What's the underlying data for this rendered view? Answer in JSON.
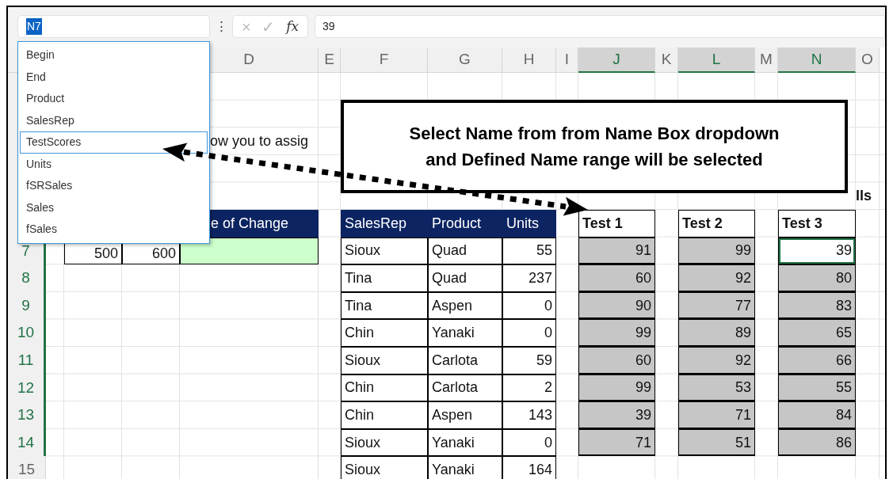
{
  "name_box": {
    "value": "N7"
  },
  "formula_bar": {
    "menu_glyph": "⋮",
    "cancel_glyph": "×",
    "enter_glyph": "✓",
    "function_label": "fx",
    "value": "39"
  },
  "columns": [
    {
      "label": "D",
      "selected": false
    },
    {
      "label": "E",
      "selected": false
    },
    {
      "label": "F",
      "selected": false
    },
    {
      "label": "G",
      "selected": false
    },
    {
      "label": "H",
      "selected": false
    },
    {
      "label": "I",
      "selected": false
    },
    {
      "label": "J",
      "selected": true
    },
    {
      "label": "K",
      "selected": false
    },
    {
      "label": "L",
      "selected": true
    },
    {
      "label": "M",
      "selected": false
    },
    {
      "label": "N",
      "selected": true
    },
    {
      "label": "O",
      "selected": false
    }
  ],
  "rows": [
    {
      "label": "7",
      "selected": true
    },
    {
      "label": "8",
      "selected": true
    },
    {
      "label": "9",
      "selected": true
    },
    {
      "label": "10",
      "selected": true
    },
    {
      "label": "11",
      "selected": true
    },
    {
      "label": "12",
      "selected": true
    },
    {
      "label": "13",
      "selected": true
    },
    {
      "label": "14",
      "selected": true
    },
    {
      "label": "15",
      "selected": false
    }
  ],
  "note": {
    "text": "ow you to assig"
  },
  "note_end": {
    "text": "lls"
  },
  "change_table": {
    "header": "e of Change",
    "values": [
      "500",
      "600"
    ]
  },
  "sales_table": {
    "columns": [
      "SalesRep",
      "Product",
      "Units"
    ],
    "rows": [
      [
        "Sioux",
        "Quad",
        "55"
      ],
      [
        "Tina",
        "Quad",
        "237"
      ],
      [
        "Tina",
        "Aspen",
        "0"
      ],
      [
        "Chin",
        "Yanaki",
        "0"
      ],
      [
        "Sioux",
        "Carlota",
        "59"
      ],
      [
        "Chin",
        "Carlota",
        "2"
      ],
      [
        "Chin",
        "Aspen",
        "143"
      ],
      [
        "Sioux",
        "Yanaki",
        "0"
      ],
      [
        "Sioux",
        "Yanaki",
        "164"
      ]
    ]
  },
  "test_tables": [
    {
      "title": "Test 1",
      "scores": [
        {
          "text": "91",
          "active": false
        },
        {
          "text": "60",
          "active": false
        },
        {
          "text": "90",
          "active": false
        },
        {
          "text": "99",
          "active": false
        },
        {
          "text": "60",
          "active": false
        },
        {
          "text": "99",
          "active": false
        },
        {
          "text": "39",
          "active": false
        },
        {
          "text": "71",
          "active": false
        }
      ]
    },
    {
      "title": "Test 2",
      "scores": [
        {
          "text": "99",
          "active": false
        },
        {
          "text": "92",
          "active": false
        },
        {
          "text": "77",
          "active": false
        },
        {
          "text": "89",
          "active": false
        },
        {
          "text": "92",
          "active": false
        },
        {
          "text": "53",
          "active": false
        },
        {
          "text": "71",
          "active": false
        },
        {
          "text": "51",
          "active": false
        }
      ]
    },
    {
      "title": "Test 3",
      "scores": [
        {
          "text": "39",
          "active": true
        },
        {
          "text": "80",
          "active": false
        },
        {
          "text": "83",
          "active": false
        },
        {
          "text": "65",
          "active": false
        },
        {
          "text": "66",
          "active": false
        },
        {
          "text": "55",
          "active": false
        },
        {
          "text": "84",
          "active": false
        },
        {
          "text": "86",
          "active": false
        }
      ]
    }
  ],
  "name_dropdown": {
    "items": [
      {
        "label": "Begin",
        "selected": false
      },
      {
        "label": "End",
        "selected": false
      },
      {
        "label": "Product",
        "selected": false
      },
      {
        "label": "SalesRep",
        "selected": false
      },
      {
        "label": "TestScores",
        "selected": true
      },
      {
        "label": "Units",
        "selected": false
      },
      {
        "label": "fSRSales",
        "selected": false
      },
      {
        "label": "Sales",
        "selected": false
      },
      {
        "label": "fSales",
        "selected": false
      }
    ]
  },
  "callout": {
    "lines": [
      "Select Name from from Name Box dropdown",
      "and Defined Name range will be selected"
    ]
  }
}
